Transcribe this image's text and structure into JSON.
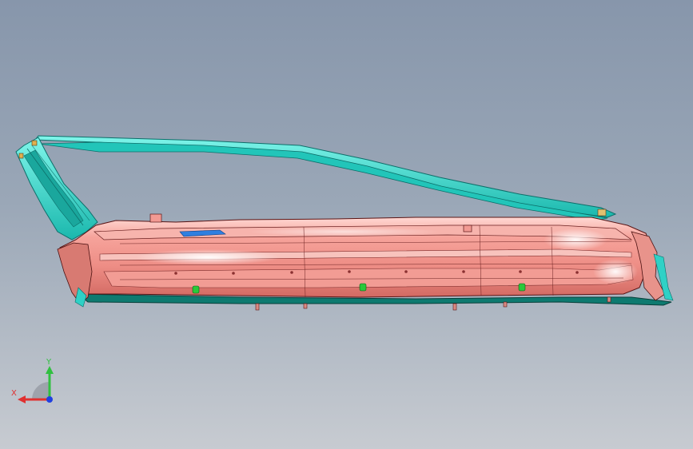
{
  "viewport": {
    "background_top": "#8796ab",
    "background_bottom": "#c7cbd1"
  },
  "model": {
    "frame_color": "#2fd1c6",
    "frame_edge_color": "#0c6f6a",
    "panel_color": "#f29a93",
    "panel_highlight": "#ffe6e2",
    "panel_shadow": "#c05a55",
    "base_color": "#0e7a70",
    "clip_color": "#29c93a",
    "accent_blue": "#2f7fe0",
    "edge_color": "#4a1010"
  },
  "triad": {
    "x_label": "X",
    "y_label": "Y",
    "x_color": "#e03030",
    "y_color": "#30c040",
    "z_color": "#2040e0"
  }
}
